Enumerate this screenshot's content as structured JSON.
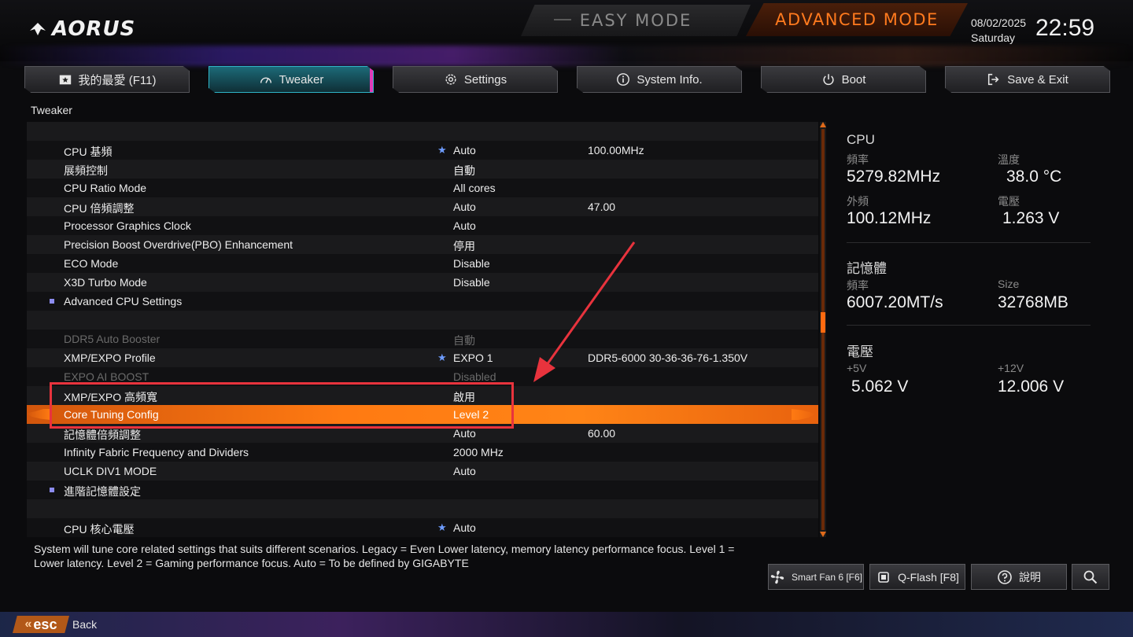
{
  "header": {
    "logo_text": "AORUS",
    "easy_mode_label": "EASY MODE",
    "advanced_mode_label": "ADVANCED MODE",
    "date": "08/02/2025",
    "day": "Saturday",
    "time": "22:59"
  },
  "tabs": [
    {
      "label": "我的最愛 (F11)",
      "icon": "star-folder-icon"
    },
    {
      "label": "Tweaker",
      "icon": "speedometer-icon",
      "active": true
    },
    {
      "label": "Settings",
      "icon": "gear-icon"
    },
    {
      "label": "System Info.",
      "icon": "info-icon"
    },
    {
      "label": "Boot",
      "icon": "power-icon"
    },
    {
      "label": "Save & Exit",
      "icon": "exit-icon"
    }
  ],
  "breadcrumb": "Tweaker",
  "settings": [
    {
      "name": "",
      "value": "",
      "current": ""
    },
    {
      "name": "CPU 基頻",
      "value": "Auto",
      "current": "100.00MHz",
      "star": true
    },
    {
      "name": "展頻控制",
      "value": "自動",
      "current": ""
    },
    {
      "name": "CPU Ratio Mode",
      "value": "All cores",
      "current": ""
    },
    {
      "name": "CPU 倍頻調整",
      "value": "Auto",
      "current": "47.00"
    },
    {
      "name": "Processor Graphics Clock",
      "value": "Auto",
      "current": ""
    },
    {
      "name": "Precision Boost Overdrive(PBO) Enhancement",
      "value": "停用",
      "current": ""
    },
    {
      "name": "ECO Mode",
      "value": "Disable",
      "current": ""
    },
    {
      "name": "X3D Turbo Mode",
      "value": "Disable",
      "current": ""
    },
    {
      "name": "Advanced CPU Settings",
      "value": "",
      "current": "",
      "submenu": true
    },
    {
      "name": "",
      "value": "",
      "current": ""
    },
    {
      "name": "DDR5 Auto Booster",
      "value": "自動",
      "current": "",
      "dim": true
    },
    {
      "name": "XMP/EXPO Profile",
      "value": "EXPO 1",
      "current": "DDR5-6000 30-36-36-76-1.350V",
      "star": true
    },
    {
      "name": "EXPO AI BOOST",
      "value": "Disabled",
      "current": "",
      "dim": true
    },
    {
      "name": "XMP/EXPO 高頻寬",
      "value": "啟用",
      "current": ""
    },
    {
      "name": "Core Tuning Config",
      "value": "Level 2",
      "current": "",
      "selected": true
    },
    {
      "name": "記憶體倍頻調整",
      "value": "Auto",
      "current": "60.00"
    },
    {
      "name": "Infinity Fabric Frequency and Dividers",
      "value": "2000 MHz",
      "current": ""
    },
    {
      "name": "UCLK DIV1 MODE",
      "value": "Auto",
      "current": ""
    },
    {
      "name": "進階記憶體設定",
      "value": "",
      "current": "",
      "submenu": true
    },
    {
      "name": "",
      "value": "",
      "current": ""
    },
    {
      "name": "CPU 核心電壓",
      "value": "Auto",
      "current": "",
      "star": true
    }
  ],
  "help_text": "System will tune core related settings that suits different scenarios. Legacy = Even Lower latency, memory latency performance focus. Level 1 = Lower latency. Level 2 = Gaming performance focus. Auto = To be defined by GIGABYTE",
  "monitor": {
    "cpu": {
      "title": "CPU",
      "freq_label": "頻率",
      "freq": "5279.82MHz",
      "temp_label": "溫度",
      "temp": "38.0 °C",
      "bclk_label": "外頻",
      "bclk": "100.12MHz",
      "volt_label": "電壓",
      "volt": "1.263 V"
    },
    "memory": {
      "title": "記憶體",
      "freq_label": "頻率",
      "freq": "6007.20MT/s",
      "size_label": "Size",
      "size": "32768MB"
    },
    "voltage": {
      "title": "電壓",
      "v5_label": "+5V",
      "v5": "5.062 V",
      "v12_label": "+12V",
      "v12": "12.006 V"
    }
  },
  "bottom_buttons": {
    "smart_fan": "Smart Fan 6 [F6]",
    "qflash": "Q-Flash [F8]",
    "help": "說明"
  },
  "footer": {
    "esc_label": "esc",
    "back_label": "Back"
  },
  "colors": {
    "accent_orange": "#ff7a12",
    "active_tab_teal": "#1c6a78",
    "annotation_red": "#e8333d",
    "star_blue": "#6e9cff"
  }
}
